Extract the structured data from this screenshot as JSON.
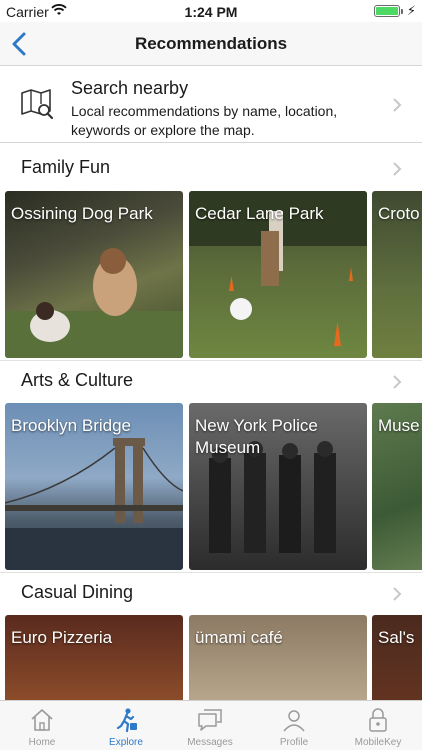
{
  "status_bar": {
    "carrier": "Carrier",
    "time": "1:24 PM",
    "battery_level": 1.0
  },
  "nav": {
    "title": "Recommendations",
    "back_icon": "chevron-left-icon"
  },
  "search_nearby": {
    "title": "Search nearby",
    "description": "Local recommendations by name, location, keywords or explore the map.",
    "icon": "map-search-icon"
  },
  "sections": [
    {
      "title": "Family Fun",
      "cards": [
        "Ossining Dog Park",
        "Cedar Lane Park",
        "Croto"
      ]
    },
    {
      "title": "Arts & Culture",
      "cards": [
        "Brooklyn Bridge",
        "New York Police Museum",
        "Muse Amer"
      ]
    },
    {
      "title": "Casual Dining",
      "cards": [
        "Euro Pizzeria",
        "ümami café",
        "Sal's"
      ]
    }
  ],
  "tabs": [
    {
      "label": "Home",
      "icon": "home-icon"
    },
    {
      "label": "Explore",
      "icon": "explore-walker-icon",
      "active": true
    },
    {
      "label": "Messages",
      "icon": "messages-icon"
    },
    {
      "label": "Profile",
      "icon": "profile-icon"
    },
    {
      "label": "MobileKey",
      "icon": "mobilekey-lock-icon"
    }
  ],
  "colors": {
    "accent": "#2f7ac8",
    "battery": "#4cd964",
    "tab_inactive": "#9a9a9a"
  }
}
